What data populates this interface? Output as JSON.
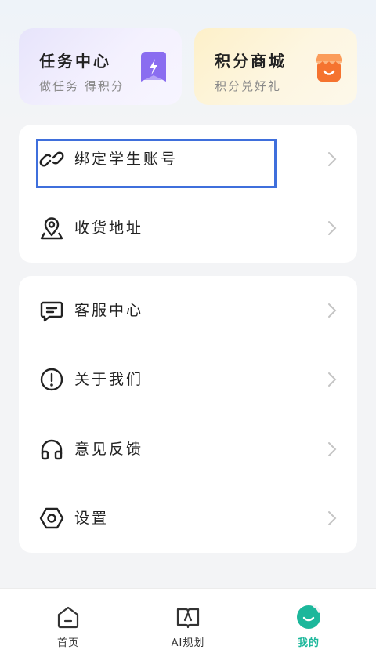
{
  "cards": {
    "task": {
      "title": "任务中心",
      "subtitle": "做任务 得积分",
      "icon": "lightning-bookmark-icon"
    },
    "mall": {
      "title": "积分商城",
      "subtitle": "积分兑好礼",
      "icon": "shop-icon"
    }
  },
  "menu_group1": [
    {
      "label": "绑定学生账号",
      "icon": "link-icon"
    },
    {
      "label": "收货地址",
      "icon": "location-pin-icon"
    }
  ],
  "menu_group2": [
    {
      "label": "客服中心",
      "icon": "message-icon"
    },
    {
      "label": "关于我们",
      "icon": "info-circle-icon"
    },
    {
      "label": "意见反馈",
      "icon": "headphones-icon"
    },
    {
      "label": "设置",
      "icon": "settings-hexagon-icon"
    }
  ],
  "tabbar": [
    {
      "label": "首页",
      "icon": "home-icon",
      "active": false
    },
    {
      "label": "AI规划",
      "icon": "ai-book-icon",
      "active": false
    },
    {
      "label": "我的",
      "icon": "profile-face-icon",
      "active": true
    }
  ],
  "colors": {
    "accent": "#1cb79b",
    "highlight": "#3f6fdc",
    "task_card": "#e7e4fb",
    "mall_card": "#fdf0c9",
    "shop_orange": "#f5732f",
    "task_purple": "#8a6df0"
  }
}
